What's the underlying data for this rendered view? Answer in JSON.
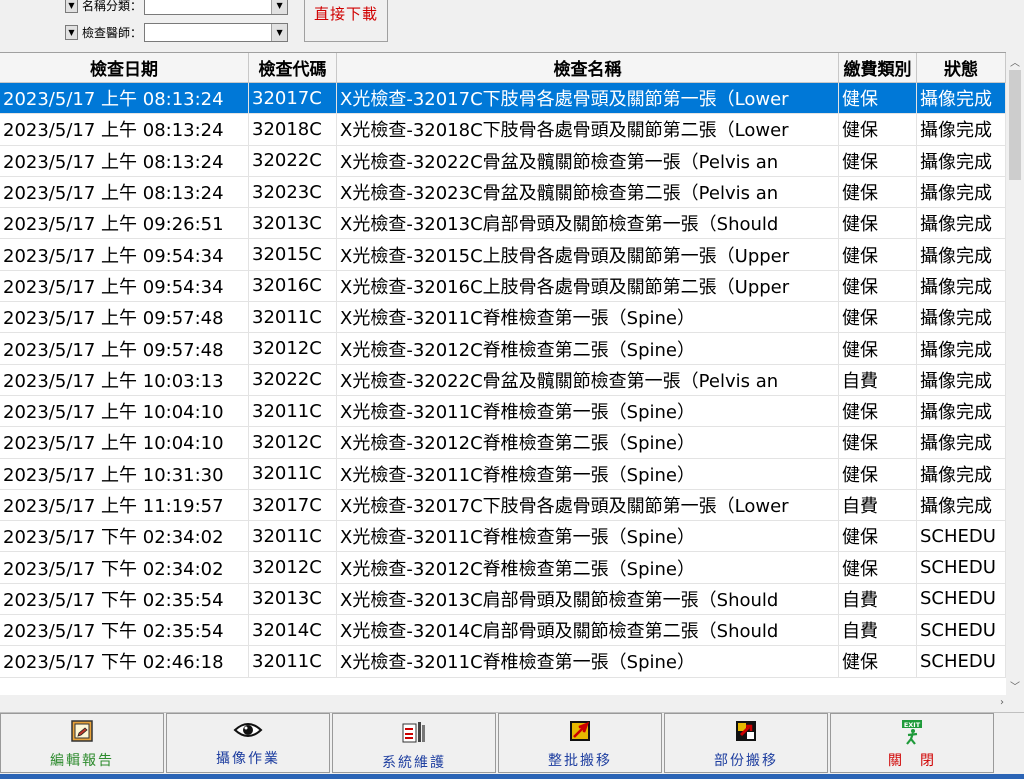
{
  "filters": {
    "name_category_label": "名稱分類：",
    "name_category_value": "",
    "doctor_label": "檢查醫師：",
    "doctor_value": ""
  },
  "download_button": "直接下載",
  "table": {
    "columns": [
      "檢查日期",
      "檢查代碼",
      "檢查名稱",
      "繳費類別",
      "狀態"
    ],
    "rows": [
      {
        "date": "2023/5/17 上午 08:13:24",
        "code": "32017C",
        "name": "X光檢查-32017C下肢骨各處骨頭及關節第一張（Lower",
        "pay": "健保",
        "status": "攝像完成"
      },
      {
        "date": "2023/5/17 上午 08:13:24",
        "code": "32018C",
        "name": "X光檢查-32018C下肢骨各處骨頭及關節第二張（Lower",
        "pay": "健保",
        "status": "攝像完成"
      },
      {
        "date": "2023/5/17 上午 08:13:24",
        "code": "32022C",
        "name": "X光檢查-32022C骨盆及髖關節檢查第一張（Pelvis an",
        "pay": "健保",
        "status": "攝像完成"
      },
      {
        "date": "2023/5/17 上午 08:13:24",
        "code": "32023C",
        "name": "X光檢查-32023C骨盆及髖關節檢查第二張（Pelvis an",
        "pay": "健保",
        "status": "攝像完成"
      },
      {
        "date": "2023/5/17 上午 09:26:51",
        "code": "32013C",
        "name": "X光檢查-32013C肩部骨頭及關節檢查第一張（Should",
        "pay": "健保",
        "status": "攝像完成"
      },
      {
        "date": "2023/5/17 上午 09:54:34",
        "code": "32015C",
        "name": "X光檢查-32015C上肢骨各處骨頭及關節第一張（Upper",
        "pay": "健保",
        "status": "攝像完成"
      },
      {
        "date": "2023/5/17 上午 09:54:34",
        "code": "32016C",
        "name": "X光檢查-32016C上肢骨各處骨頭及關節第二張（Upper",
        "pay": "健保",
        "status": "攝像完成"
      },
      {
        "date": "2023/5/17 上午 09:57:48",
        "code": "32011C",
        "name": "X光檢查-32011C脊椎檢查第一張（Spine）",
        "pay": "健保",
        "status": "攝像完成"
      },
      {
        "date": "2023/5/17 上午 09:57:48",
        "code": "32012C",
        "name": "X光檢查-32012C脊椎檢查第二張（Spine）",
        "pay": "健保",
        "status": "攝像完成"
      },
      {
        "date": "2023/5/17 上午 10:03:13",
        "code": "32022C",
        "name": "X光檢查-32022C骨盆及髖關節檢查第一張（Pelvis an",
        "pay": "自費",
        "status": "攝像完成"
      },
      {
        "date": "2023/5/17 上午 10:04:10",
        "code": "32011C",
        "name": "X光檢查-32011C脊椎檢查第一張（Spine）",
        "pay": "健保",
        "status": "攝像完成"
      },
      {
        "date": "2023/5/17 上午 10:04:10",
        "code": "32012C",
        "name": "X光檢查-32012C脊椎檢查第二張（Spine）",
        "pay": "健保",
        "status": "攝像完成"
      },
      {
        "date": "2023/5/17 上午 10:31:30",
        "code": "32011C",
        "name": "X光檢查-32011C脊椎檢查第一張（Spine）",
        "pay": "健保",
        "status": "攝像完成"
      },
      {
        "date": "2023/5/17 上午 11:19:57",
        "code": "32017C",
        "name": "X光檢查-32017C下肢骨各處骨頭及關節第一張（Lower",
        "pay": "自費",
        "status": "攝像完成"
      },
      {
        "date": "2023/5/17 下午 02:34:02",
        "code": "32011C",
        "name": "X光檢查-32011C脊椎檢查第一張（Spine）",
        "pay": "健保",
        "status": "SCHEDU"
      },
      {
        "date": "2023/5/17 下午 02:34:02",
        "code": "32012C",
        "name": "X光檢查-32012C脊椎檢查第二張（Spine）",
        "pay": "健保",
        "status": "SCHEDU"
      },
      {
        "date": "2023/5/17 下午 02:35:54",
        "code": "32013C",
        "name": "X光檢查-32013C肩部骨頭及關節檢查第一張（Should",
        "pay": "自費",
        "status": "SCHEDU"
      },
      {
        "date": "2023/5/17 下午 02:35:54",
        "code": "32014C",
        "name": "X光檢查-32014C肩部骨頭及關節檢查第二張（Should",
        "pay": "自費",
        "status": "SCHEDU"
      },
      {
        "date": "2023/5/17 下午 02:46:18",
        "code": "32011C",
        "name": "X光檢查-32011C脊椎檢查第一張（Spine）",
        "pay": "健保",
        "status": "SCHEDU"
      }
    ]
  },
  "toolbar": {
    "edit_report": "編輯報告",
    "imaging": "攝像作業",
    "maintenance": "系統維護",
    "batch_move": "整批搬移",
    "partial_move": "部份搬移",
    "exit_icon_text": "EXIT",
    "close": "關　閉"
  },
  "colors": {
    "selection": "#0078d7",
    "edit_label": "#2e8b2e",
    "blue_label": "#1f3fa0",
    "close_label": "#d00000"
  },
  "icons": [
    "report-edit-icon",
    "eye-icon",
    "maintenance-icon",
    "batch-move-icon",
    "partial-move-icon",
    "exit-icon"
  ]
}
